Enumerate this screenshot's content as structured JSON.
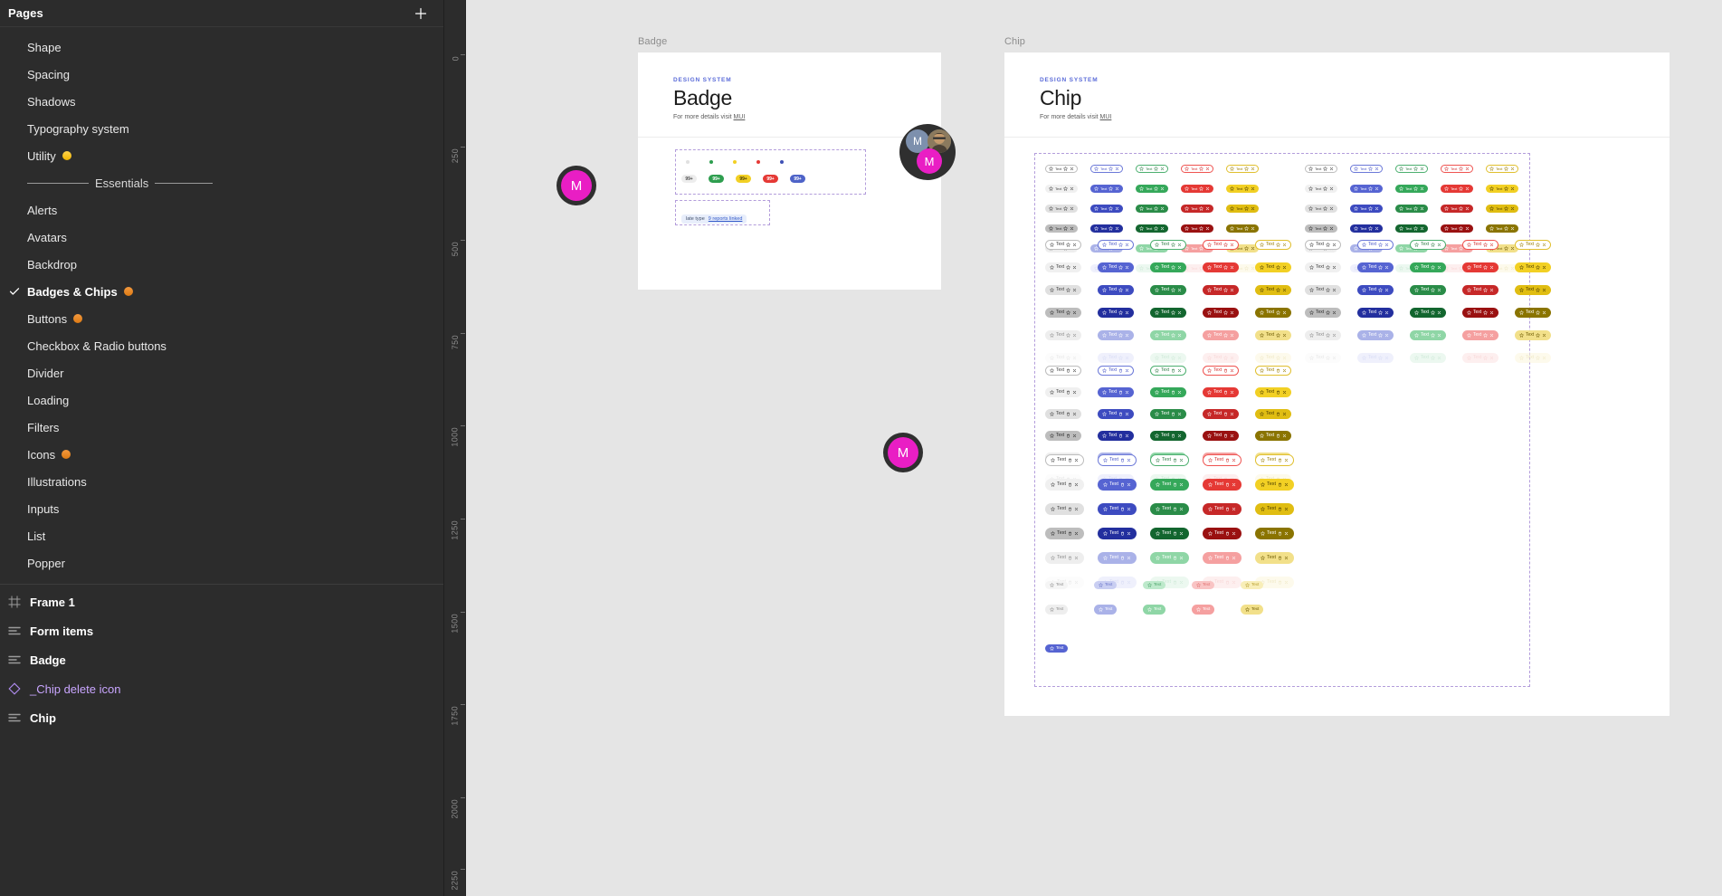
{
  "panel": {
    "title": "Pages",
    "add_icon": "plus-icon",
    "pages": [
      {
        "label": "Shape",
        "selected": false,
        "badge": null
      },
      {
        "label": "Spacing",
        "selected": false,
        "badge": null
      },
      {
        "label": "Shadows",
        "selected": false,
        "badge": null
      },
      {
        "label": "Typography system",
        "selected": false,
        "badge": null
      },
      {
        "label": "Utility",
        "selected": false,
        "badge": "yellow"
      },
      {
        "label": "Essentials",
        "divider": true
      },
      {
        "label": "Alerts",
        "selected": false,
        "badge": null
      },
      {
        "label": "Avatars",
        "selected": false,
        "badge": null
      },
      {
        "label": "Backdrop",
        "selected": false,
        "badge": null
      },
      {
        "label": "Badges & Chips",
        "selected": true,
        "badge": "orange"
      },
      {
        "label": "Buttons",
        "selected": false,
        "badge": "orange"
      },
      {
        "label": "Checkbox & Radio buttons",
        "selected": false,
        "badge": null
      },
      {
        "label": "Divider",
        "selected": false,
        "badge": null
      },
      {
        "label": "Loading",
        "selected": false,
        "badge": null
      },
      {
        "label": "Filters",
        "selected": false,
        "badge": null
      },
      {
        "label": "Icons",
        "selected": false,
        "badge": "orange"
      },
      {
        "label": "Illustrations",
        "selected": false,
        "badge": null
      },
      {
        "label": "Inputs",
        "selected": false,
        "badge": null
      },
      {
        "label": "List",
        "selected": false,
        "badge": null
      },
      {
        "label": "Popper",
        "selected": false,
        "badge": null
      }
    ],
    "layers": [
      {
        "label": "Frame 1",
        "icon": "frame-icon",
        "type": "frame"
      },
      {
        "label": "Form items",
        "icon": "autolayout-icon",
        "type": "group"
      },
      {
        "label": "Badge",
        "icon": "autolayout-icon",
        "type": "group"
      },
      {
        "label": "_Chip delete icon",
        "icon": "component-icon",
        "type": "component"
      },
      {
        "label": "Chip",
        "icon": "autolayout-icon",
        "type": "group"
      }
    ]
  },
  "ruler": {
    "ticks": [
      "0",
      "250",
      "500",
      "750",
      "1000",
      "1250",
      "1500",
      "1750",
      "2000",
      "2250"
    ]
  },
  "canvas": {
    "frames": [
      {
        "name": "Badge",
        "eyebrow": "DESIGN SYSTEM",
        "title": "Badge",
        "subtitle_prefix": "For more details visit ",
        "subtitle_link": "MUI",
        "badge_dots": [
          "#e0e0e0",
          "#2e9e4f",
          "#f2d024",
          "#e53935",
          "#3f51b5"
        ],
        "badge_pills": [
          {
            "label": "99+",
            "bg": "#ededed",
            "fg": "#4f4f4f"
          },
          {
            "label": "99+",
            "bg": "#2e9e4f",
            "fg": "#ffffff"
          },
          {
            "label": "99+",
            "bg": "#f2d024",
            "fg": "#4a3c00"
          },
          {
            "label": "99+",
            "bg": "#e53935",
            "fg": "#ffffff"
          },
          {
            "label": "99+",
            "bg": "#4e63c8",
            "fg": "#ffffff"
          }
        ],
        "note": {
          "prefix": "late type",
          "link": "9 reports linked"
        }
      },
      {
        "name": "Chip",
        "eyebrow": "DESIGN SYSTEM",
        "title": "Chip",
        "subtitle_prefix": "For more details visit ",
        "subtitle_link": "MUI",
        "chip_label": "Text",
        "chip_icons": [
          "star-icon",
          "delete-icon",
          "close-icon"
        ],
        "palette_names": [
          "default",
          "primary",
          "success",
          "error",
          "warning"
        ],
        "palette": [
          "#9e9e9e",
          "#5664d2",
          "#2e9e4f",
          "#e53935",
          "#e8c33a"
        ]
      }
    ]
  },
  "cursors": [
    {
      "initial": "M",
      "color": "#e91ec4",
      "name": "magenta-avatar"
    },
    {
      "initial": "M",
      "color": "#7d90ad",
      "name": "slate-avatar"
    },
    {
      "initial": "",
      "color": "#6b7a8f",
      "name": "photo-avatar"
    }
  ]
}
